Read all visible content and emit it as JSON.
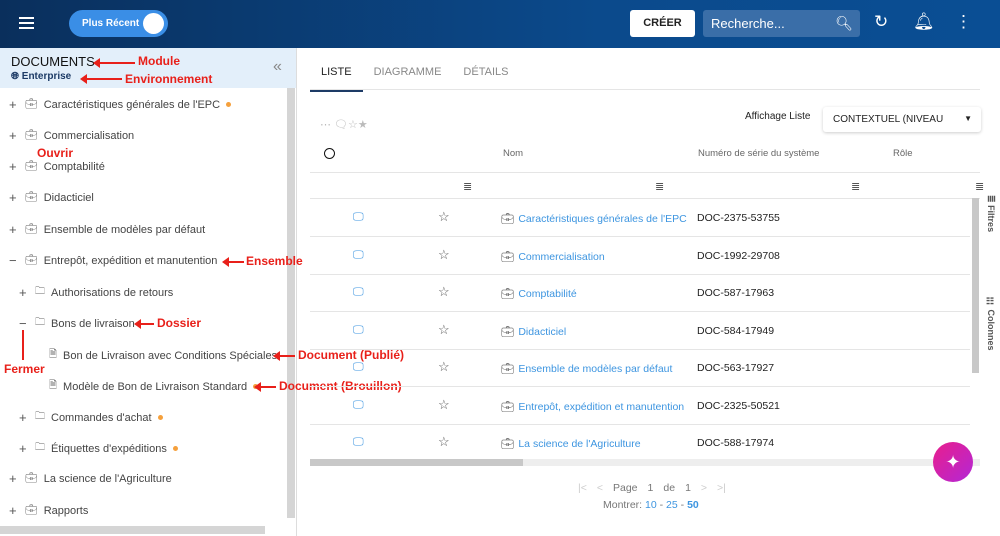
{
  "header": {
    "toggle_label": "Plus Récent",
    "create_label": "CRÉER",
    "search_placeholder": "Recherche..."
  },
  "sidebar": {
    "title": "DOCUMENTS",
    "environment": "Enterprise",
    "items": [
      {
        "label": "Caractéristiques générales de l'EPC",
        "toggle": "+",
        "dot": true
      },
      {
        "label": "Commercialisation",
        "toggle": "+"
      },
      {
        "label": "Comptabilité",
        "toggle": "+"
      },
      {
        "label": "Didacticiel",
        "toggle": "+"
      },
      {
        "label": "Ensemble de modèles par défaut",
        "toggle": "+"
      },
      {
        "label": "Entrepôt, expédition et manutention",
        "toggle": "−"
      },
      {
        "label": "Authorisations de retours",
        "toggle": "+"
      },
      {
        "label": "Bons de livraison",
        "toggle": "−"
      },
      {
        "label": "Bon de Livraison avec Conditions Spéciales"
      },
      {
        "label": "Modèle de Bon de Livraison Standard",
        "dot": true
      },
      {
        "label": "Commandes d'achat",
        "toggle": "+",
        "dot": true
      },
      {
        "label": "Étiquettes d'expéditions",
        "toggle": "+",
        "dot": true
      },
      {
        "label": "La science de l'Agriculture",
        "toggle": "+"
      },
      {
        "label": "Rapports",
        "toggle": "+"
      }
    ]
  },
  "annotations": {
    "module": "Module",
    "environment": "Environnement",
    "open": "Ouvrir",
    "set": "Ensemble",
    "folder": "Dossier",
    "close": "Fermer",
    "doc_published": "Document (Publié)",
    "doc_draft": "Document (Brouillon)"
  },
  "tabs": [
    "LISTE",
    "DIAGRAMME",
    "DÉTAILS"
  ],
  "view": {
    "label": "Affichage Liste",
    "value": "CONTEXTUEL (NIVEAU"
  },
  "table": {
    "columns": [
      "Nom",
      "Numéro de série du système",
      "Rôle"
    ],
    "rows": [
      {
        "name": "Caractéristiques générales de l'EPC",
        "serial": "DOC-2375-53755"
      },
      {
        "name": "Commercialisation",
        "serial": "DOC-1992-29708"
      },
      {
        "name": "Comptabilité",
        "serial": "DOC-587-17963"
      },
      {
        "name": "Didacticiel",
        "serial": "DOC-584-17949"
      },
      {
        "name": "Ensemble de modèles par défaut",
        "serial": "DOC-563-17927"
      },
      {
        "name": "Entrepôt, expédition et manutention",
        "serial": "DOC-2325-50521"
      },
      {
        "name": "La science de l'Agriculture",
        "serial": "DOC-588-17974"
      }
    ]
  },
  "pagination": {
    "page_label": "Page",
    "page": "1",
    "of_label": "de",
    "total": "1",
    "show_label": "Montrer:",
    "sizes": [
      "10",
      "25",
      "50"
    ]
  },
  "side_tabs": {
    "filters": "Filtres",
    "columns": "Colonnes"
  }
}
